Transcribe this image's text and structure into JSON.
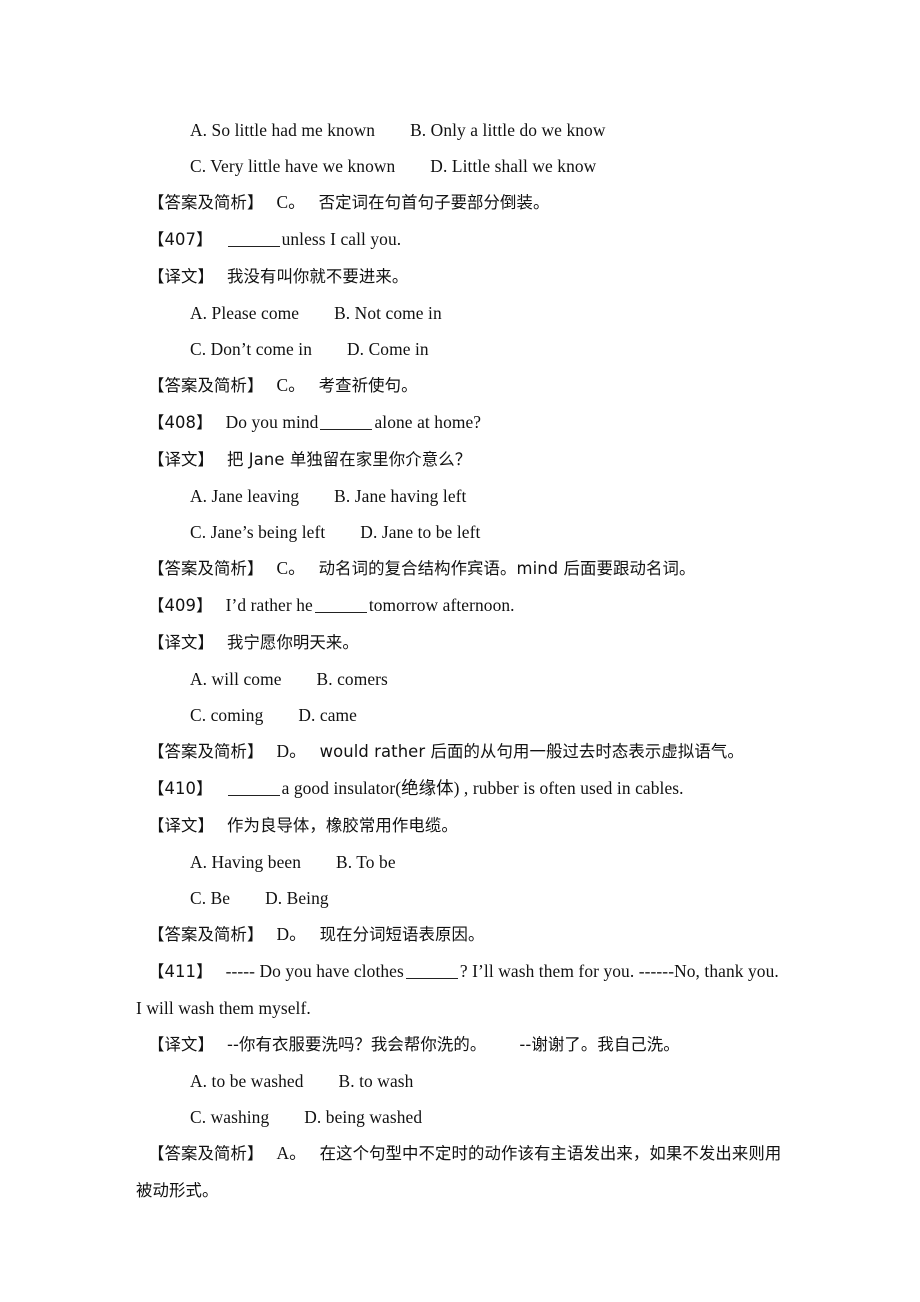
{
  "document": {
    "type": "grammar-exercise-page",
    "language": "zh-CN + en",
    "labels": {
      "answer_label": "【答案及简析】",
      "translation_label": "【译文】"
    },
    "carryover": {
      "options_ab": "A. So little had me known  B. Only a little do we know",
      "options_cd": "C. Very little have we known  D. Little shall we know",
      "answer_key": "C。",
      "answer_analysis": "否定词在句首句子要部分倒装。"
    },
    "questions": [
      {
        "number": "【407】",
        "stem_before_blank": "",
        "stem_after_blank": "unless I call you.",
        "has_blank": true,
        "translation": "我没有叫你就不要进来。",
        "options_ab": "A. Please come  B. Not come in",
        "options_cd": "C. Don’t come in  D. Come in",
        "answer_key": "C。",
        "answer_analysis": "考查祈使句。"
      },
      {
        "number": "【408】",
        "stem_before_blank": "Do you mind",
        "stem_after_blank": "alone at home?",
        "has_blank": true,
        "translation": "把 Jane 单独留在家里你介意么？",
        "options_ab": "A. Jane leaving  B. Jane having left",
        "options_cd": "C. Jane’s being left  D. Jane to be left",
        "answer_key": "C。",
        "answer_analysis": "动名词的复合结构作宾语。mind 后面要跟动名词。"
      },
      {
        "number": "【409】",
        "stem_before_blank": "I’d rather he",
        "stem_after_blank": "tomorrow afternoon.",
        "has_blank": true,
        "translation": "我宁愿你明天来。",
        "options_ab": "A. will come  B. comers",
        "options_cd": "C. coming  D. came",
        "answer_key": "D。",
        "answer_analysis": "would rather 后面的从句用一般过去时态表示虚拟语气。"
      },
      {
        "number": "【410】",
        "stem_before_blank": "",
        "stem_after_blank": "a good insulator(绝缘体) , rubber is often used in cables.",
        "has_blank": true,
        "translation": "作为良导体，橡胶常用作电缆。",
        "options_ab": "A. Having been  B. To be",
        "options_cd": "C. Be  D. Being",
        "answer_key": "D。",
        "answer_analysis": "现在分词短语表原因。"
      },
      {
        "number": "【411】",
        "stem_before_blank": "----- Do you have clothes",
        "stem_after_blank": "? I’ll wash them for you. ------No, thank you. I will wash them myself.",
        "has_blank": true,
        "translation": "--你有衣服要洗吗？我会帮你洗的。  --谢谢了。我自己洗。",
        "options_ab": "A. to be washed  B. to wash",
        "options_cd": "C. washing  D. being washed",
        "answer_key": "A。",
        "answer_analysis": "在这个句型中不定时的动作该有主语发出来，如果不发出来则用被动形式。"
      }
    ]
  }
}
